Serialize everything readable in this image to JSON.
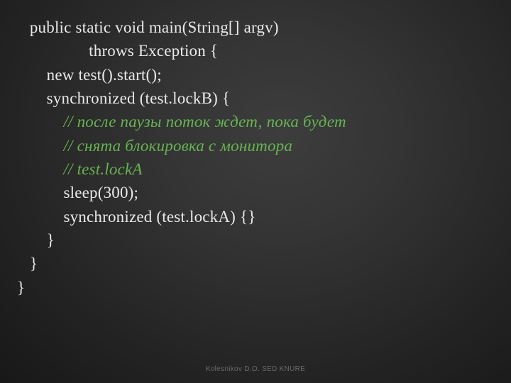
{
  "code": {
    "line1": "   public static void main(String[] argv)",
    "line2": "                 throws Exception {",
    "line3": "       new test().start();",
    "line4": "       synchronized (test.lockB) {",
    "line5": "           // после паузы поток ждет, пока будет",
    "line6": "           // снята блокировка с монитора",
    "line7": "           // test.lockA",
    "line8": "           sleep(300);",
    "line9": "           synchronized (test.lockA) {}",
    "line10": "       }",
    "line11": "   }",
    "line12": "}"
  },
  "footer": "Kolesnikov D.O. SED KNURE"
}
